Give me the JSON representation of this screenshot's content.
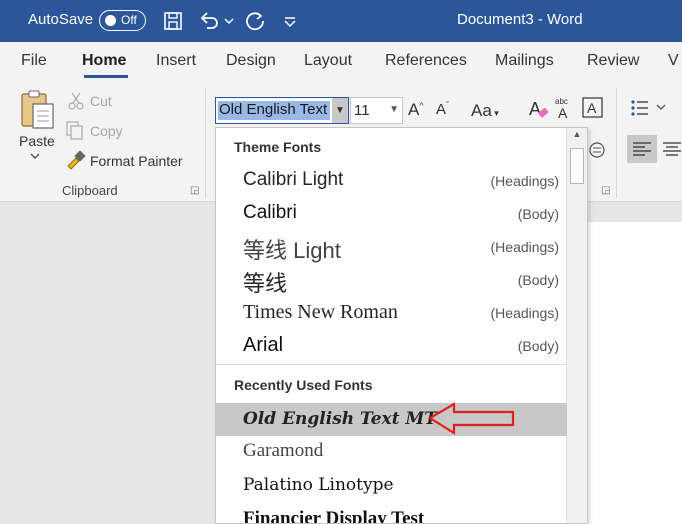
{
  "titlebar": {
    "autosave_label": "AutoSave",
    "toggle_state": "Off",
    "document_title": "Document3 - Word",
    "icons": [
      "save-icon",
      "undo-icon",
      "chevron-down-icon",
      "redo-icon",
      "customize-qat-icon"
    ]
  },
  "tabs": [
    {
      "label": "File"
    },
    {
      "label": "Home",
      "active": true
    },
    {
      "label": "Insert"
    },
    {
      "label": "Design"
    },
    {
      "label": "Layout"
    },
    {
      "label": "References"
    },
    {
      "label": "Mailings"
    },
    {
      "label": "Review"
    },
    {
      "label": "V"
    }
  ],
  "clipboard": {
    "paste_label": "Paste",
    "cut_label": "Cut",
    "copy_label": "Copy",
    "format_painter_label": "Format Painter",
    "group_label": "Clipboard"
  },
  "font_controls": {
    "font_name": "Old English Text M",
    "font_size": "11",
    "grow_label": "A",
    "shrink_label": "A",
    "case_label": "Aa"
  },
  "font_menu": {
    "theme_header": "Theme Fonts",
    "recent_header": "Recently Used Fonts",
    "theme_fonts": [
      {
        "name": "Calibri Light",
        "tag": "(Headings)"
      },
      {
        "name": "Calibri",
        "tag": "(Body)"
      },
      {
        "name": "等线 Light",
        "tag": "(Headings)"
      },
      {
        "name": "等线",
        "tag": "(Body)"
      },
      {
        "name": "Times New Roman",
        "tag": "(Headings)"
      },
      {
        "name": "Arial",
        "tag": "(Body)"
      }
    ],
    "recent_fonts": [
      {
        "name": "Old English Text MT",
        "highlighted": true
      },
      {
        "name": "Garamond"
      },
      {
        "name": "Palatino Linotype"
      },
      {
        "name": "Financier Display Test"
      }
    ]
  },
  "colors": {
    "title_bar": "#2b579a",
    "highlight": "#c8c8c8",
    "annotation_arrow": "#e02020"
  }
}
